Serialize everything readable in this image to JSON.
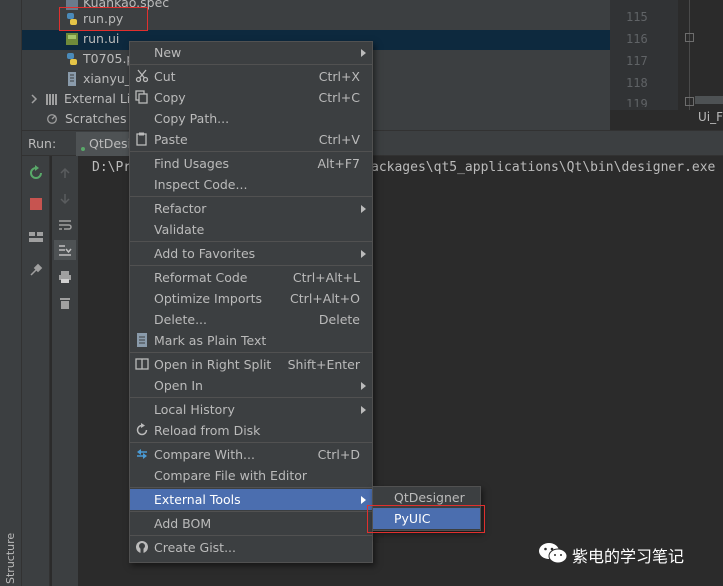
{
  "project_tree": {
    "rows": [
      {
        "label": "Kuankao.spec"
      },
      {
        "label": "run.py"
      },
      {
        "label": "run.ui"
      },
      {
        "label": "T0705.p"
      },
      {
        "label": "xianyu_s"
      },
      {
        "label": "External Lib"
      },
      {
        "label": "Scratches a"
      }
    ]
  },
  "editor": {
    "line_numbers": [
      "115",
      "116",
      "117",
      "118",
      "119"
    ],
    "tab_label": "Ui_F"
  },
  "run_panel": {
    "label": "Run:",
    "tab_label": "QtDesi",
    "console_prefix": "D:\\Pr",
    "console_suffix": "ackages\\qt5_applications\\Qt\\bin\\designer.exe"
  },
  "sidebar": {
    "structure_label": "Structure"
  },
  "context_menu": {
    "items": [
      {
        "label": "New",
        "shortcut": "",
        "submenu": true
      },
      {
        "label": "Cut",
        "shortcut": "Ctrl+X"
      },
      {
        "label": "Copy",
        "shortcut": "Ctrl+C"
      },
      {
        "label": "Copy Path...",
        "shortcut": ""
      },
      {
        "label": "Paste",
        "shortcut": "Ctrl+V"
      },
      {
        "label": "Find Usages",
        "shortcut": "Alt+F7"
      },
      {
        "label": "Inspect Code...",
        "shortcut": ""
      },
      {
        "label": "Refactor",
        "shortcut": "",
        "submenu": true
      },
      {
        "label": "Validate",
        "shortcut": ""
      },
      {
        "label": "Add to Favorites",
        "shortcut": "",
        "submenu": true
      },
      {
        "label": "Reformat Code",
        "shortcut": "Ctrl+Alt+L"
      },
      {
        "label": "Optimize Imports",
        "shortcut": "Ctrl+Alt+O"
      },
      {
        "label": "Delete...",
        "shortcut": "Delete"
      },
      {
        "label": "Mark as Plain Text",
        "shortcut": ""
      },
      {
        "label": "Open in Right Split",
        "shortcut": "Shift+Enter"
      },
      {
        "label": "Open In",
        "shortcut": "",
        "submenu": true
      },
      {
        "label": "Local History",
        "shortcut": "",
        "submenu": true
      },
      {
        "label": "Reload from Disk",
        "shortcut": ""
      },
      {
        "label": "Compare With...",
        "shortcut": "Ctrl+D"
      },
      {
        "label": "Compare File with Editor",
        "shortcut": ""
      },
      {
        "label": "External Tools",
        "shortcut": "",
        "submenu": true,
        "selected": true
      },
      {
        "label": "Add BOM",
        "shortcut": ""
      },
      {
        "label": "Create Gist...",
        "shortcut": ""
      }
    ]
  },
  "submenu": {
    "items": [
      {
        "label": "QtDesigner"
      },
      {
        "label": "PyUIC",
        "selected": true
      }
    ]
  },
  "watermark": {
    "text": "紫电的学习笔记"
  },
  "colors": {
    "menu_bg": "#3c3f41",
    "selection": "#4b6eaf",
    "highlight_box": "#e0302e",
    "editor_bg": "#2b2b2b"
  }
}
